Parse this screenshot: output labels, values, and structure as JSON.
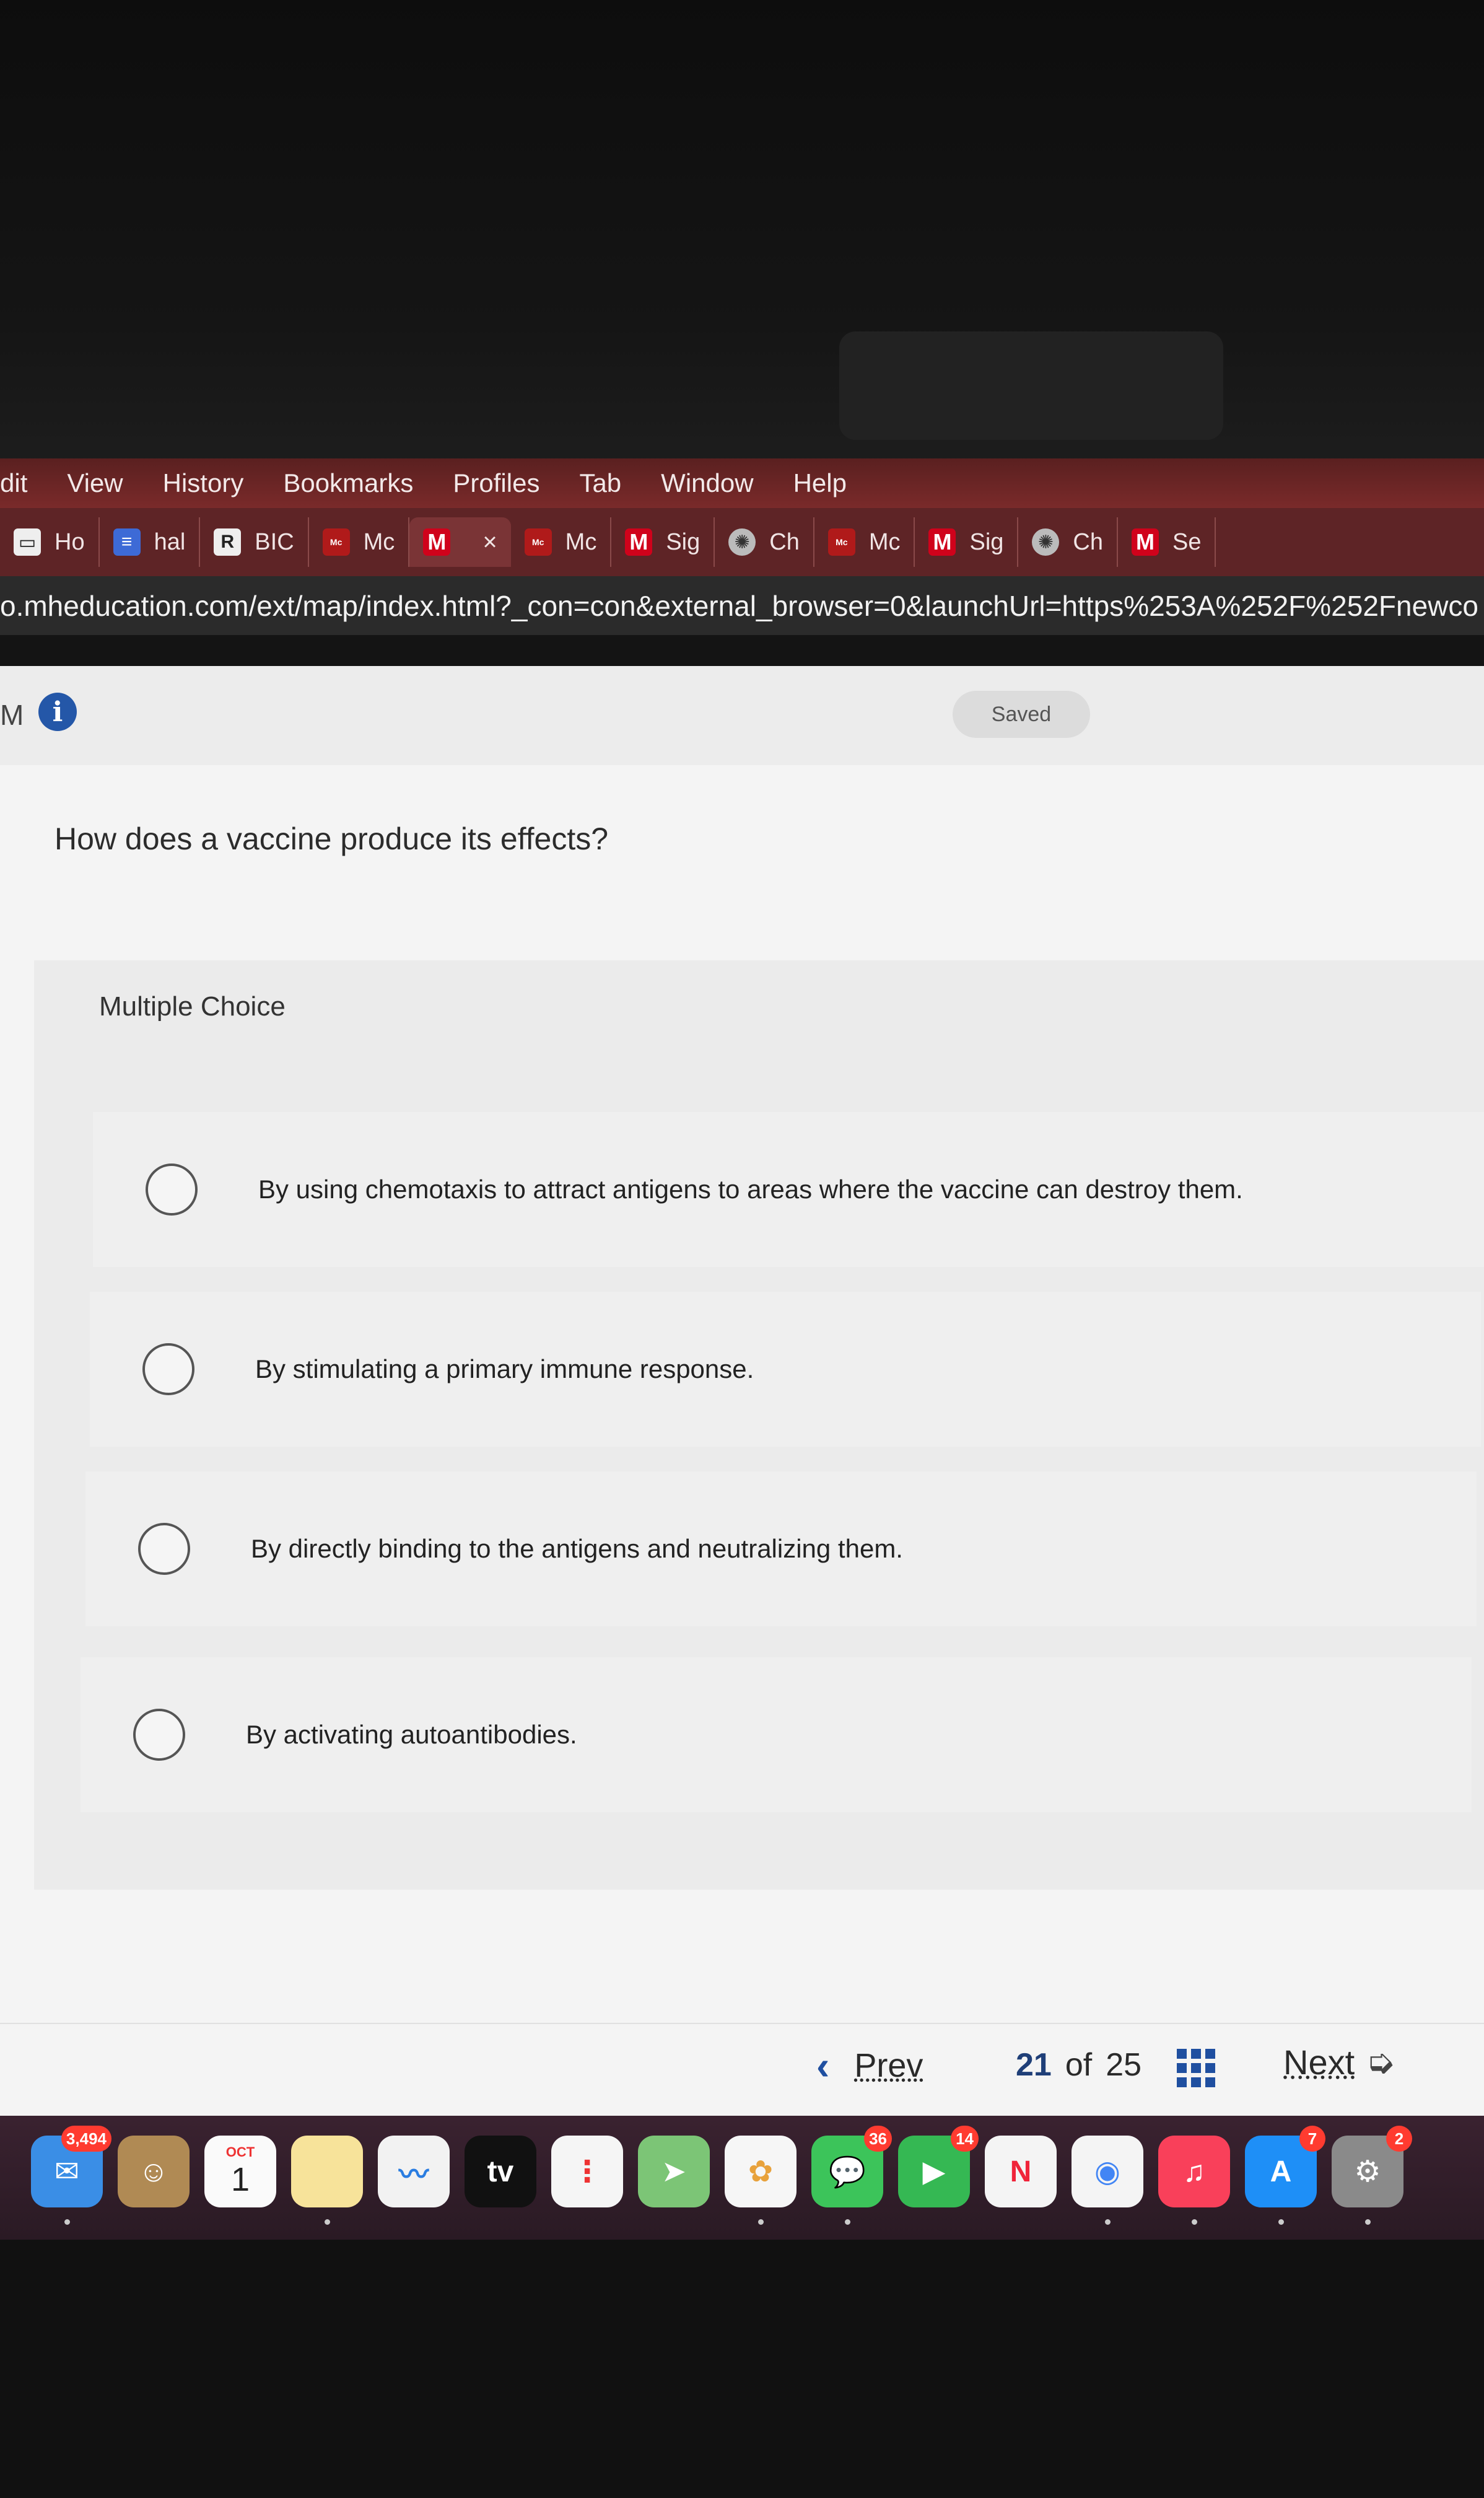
{
  "menubar": {
    "items": [
      "dit",
      "View",
      "History",
      "Bookmarks",
      "Profiles",
      "Tab",
      "Window",
      "Help"
    ]
  },
  "tabs": [
    {
      "icon": "page-icon",
      "label": "Ho"
    },
    {
      "icon": "doc-icon",
      "label": "hal"
    },
    {
      "icon": "rr-icon",
      "label": "BIC"
    },
    {
      "icon": "mcgraw-hill-icon",
      "label": "Mc"
    },
    {
      "icon": "m-icon",
      "label": "",
      "active": true,
      "close": "×"
    },
    {
      "icon": "mcgraw-hill-icon",
      "label": "Mc"
    },
    {
      "icon": "m-icon",
      "label": "Sig"
    },
    {
      "icon": "chatgpt-icon",
      "label": "Ch"
    },
    {
      "icon": "mcgraw-hill-icon",
      "label": "Mc"
    },
    {
      "icon": "m-icon",
      "label": "Sig"
    },
    {
      "icon": "chatgpt-icon",
      "label": "Ch"
    },
    {
      "icon": "m-icon",
      "label": "Se"
    }
  ],
  "address": {
    "url": "o.mheducation.com/ext/map/index.html?_con=con&external_browser=0&launchUrl=https%253A%252F%252Fnewco"
  },
  "page": {
    "brand": "M",
    "saved_label": "Saved",
    "question": "How does a vaccine produce its effects?",
    "type_label": "Multiple Choice",
    "options": [
      "By using chemotaxis to attract antigens to areas where the vaccine can destroy them.",
      "By stimulating a primary immune response.",
      "By directly binding to the antigens and neutralizing them.",
      "By activating autoantibodies."
    ]
  },
  "nav": {
    "prev_label": "Prev",
    "current": "21",
    "of_label": "of",
    "total": "25",
    "next_label": "Next"
  },
  "dock": {
    "items": [
      {
        "name": "mail-icon",
        "badge": "3,494"
      },
      {
        "name": "contacts-icon"
      },
      {
        "name": "calendar-icon",
        "month": "OCT",
        "day": "1"
      },
      {
        "name": "notes-icon"
      },
      {
        "name": "freeform-icon"
      },
      {
        "name": "tv-icon",
        "label": "tv"
      },
      {
        "name": "reminders-icon"
      },
      {
        "name": "maps-icon"
      },
      {
        "name": "photos-icon"
      },
      {
        "name": "messages-icon",
        "badge": "36"
      },
      {
        "name": "facetime-icon",
        "badge": "14"
      },
      {
        "name": "news-icon"
      },
      {
        "name": "chrome-icon"
      },
      {
        "name": "music-icon"
      },
      {
        "name": "app-store-icon",
        "badge": "7"
      },
      {
        "name": "settings-icon",
        "badge": "2"
      }
    ]
  },
  "colors": {
    "menubar": "#6e2626",
    "tabbar": "#5e2426",
    "accent_blue": "#1f4fa0",
    "badge_red": "#ff3b30"
  }
}
